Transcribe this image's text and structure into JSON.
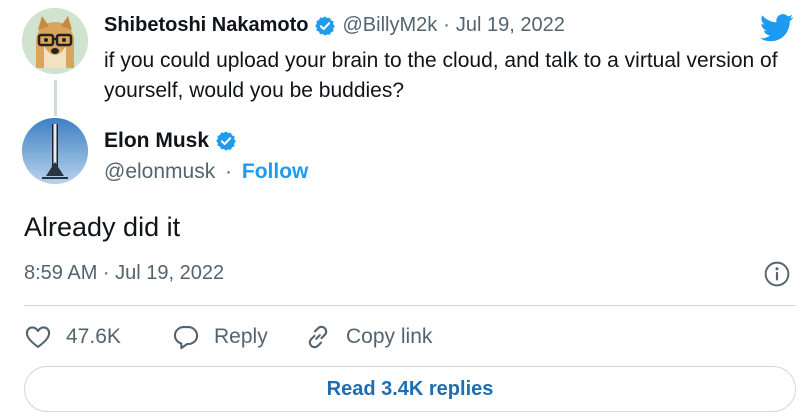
{
  "colors": {
    "accent": "#1d9bf0",
    "text": "#0f1419",
    "muted": "#536471",
    "border": "#cfd9de",
    "read_replies": "#1b6eb3"
  },
  "parent_tweet": {
    "name": "Shibetoshi Nakamoto",
    "handle": "@BillyM2k",
    "separator": "·",
    "date": "Jul 19, 2022",
    "text": "if you could upload your brain to the cloud, and talk to a virtual version of yourself, would you be buddies?",
    "avatar_icon": "doge-avatar",
    "verified_icon": "verified-badge-icon"
  },
  "main_tweet": {
    "name": "Elon Musk",
    "handle": "@elonmusk",
    "separator": "·",
    "follow_label": "Follow",
    "text": "Already did it",
    "timestamp": "8:59 AM · Jul 19, 2022",
    "avatar_icon": "rocket-avatar",
    "verified_icon": "verified-badge-icon"
  },
  "actions": {
    "likes": "47.6K",
    "reply_label": "Reply",
    "copy_label": "Copy link"
  },
  "read_replies_label": "Read 3.4K replies",
  "icons": [
    "twitter-bird-icon",
    "info-icon",
    "heart-icon",
    "reply-bubble-icon",
    "link-icon"
  ]
}
